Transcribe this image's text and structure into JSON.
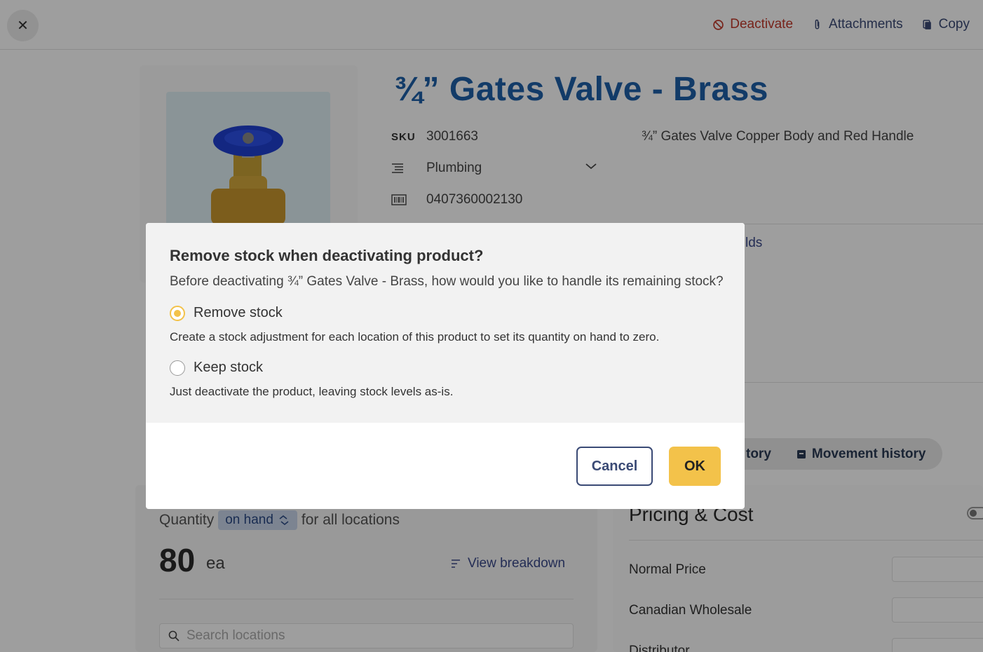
{
  "topbar": {
    "deactivate": "Deactivate",
    "attachments": "Attachments",
    "copy": "Copy"
  },
  "product": {
    "title": "¾” Gates Valve - Brass",
    "sku_label": "SKU",
    "sku": "3001663",
    "category": "Plumbing",
    "barcode": "0407360002130",
    "description": "¾” Gates Valve Copper Body and Red Handle",
    "fields_link": "lds"
  },
  "tabs": {
    "history_partial": "tory",
    "movement_history": "Movement history"
  },
  "stock": {
    "quantity_prefix": "Quantity",
    "chip": "on hand",
    "quantity_suffix": "for all locations",
    "value": "80",
    "unit": "ea",
    "breakdown": "View breakdown",
    "search_placeholder": "Search locations"
  },
  "pricing": {
    "title": "Pricing & Cost",
    "rows": [
      "Normal Price",
      "Canadian Wholesale",
      "Distributor"
    ]
  },
  "dialog": {
    "title": "Remove stock when deactivating product?",
    "question": "Before deactivating ¾” Gates Valve - Brass, how would you like to handle its remaining stock?",
    "option1_label": "Remove stock",
    "option1_desc": "Create a stock adjustment for each location of this product to set its quantity on hand to zero.",
    "option1_selected": true,
    "option2_label": "Keep stock",
    "option2_desc": "Just deactivate the product, leaving stock levels as-is.",
    "option2_selected": false,
    "cancel": "Cancel",
    "ok": "OK"
  },
  "colors": {
    "accent": "#f3c24a",
    "title_blue": "#1d5fa8",
    "danger": "#c0392b"
  }
}
